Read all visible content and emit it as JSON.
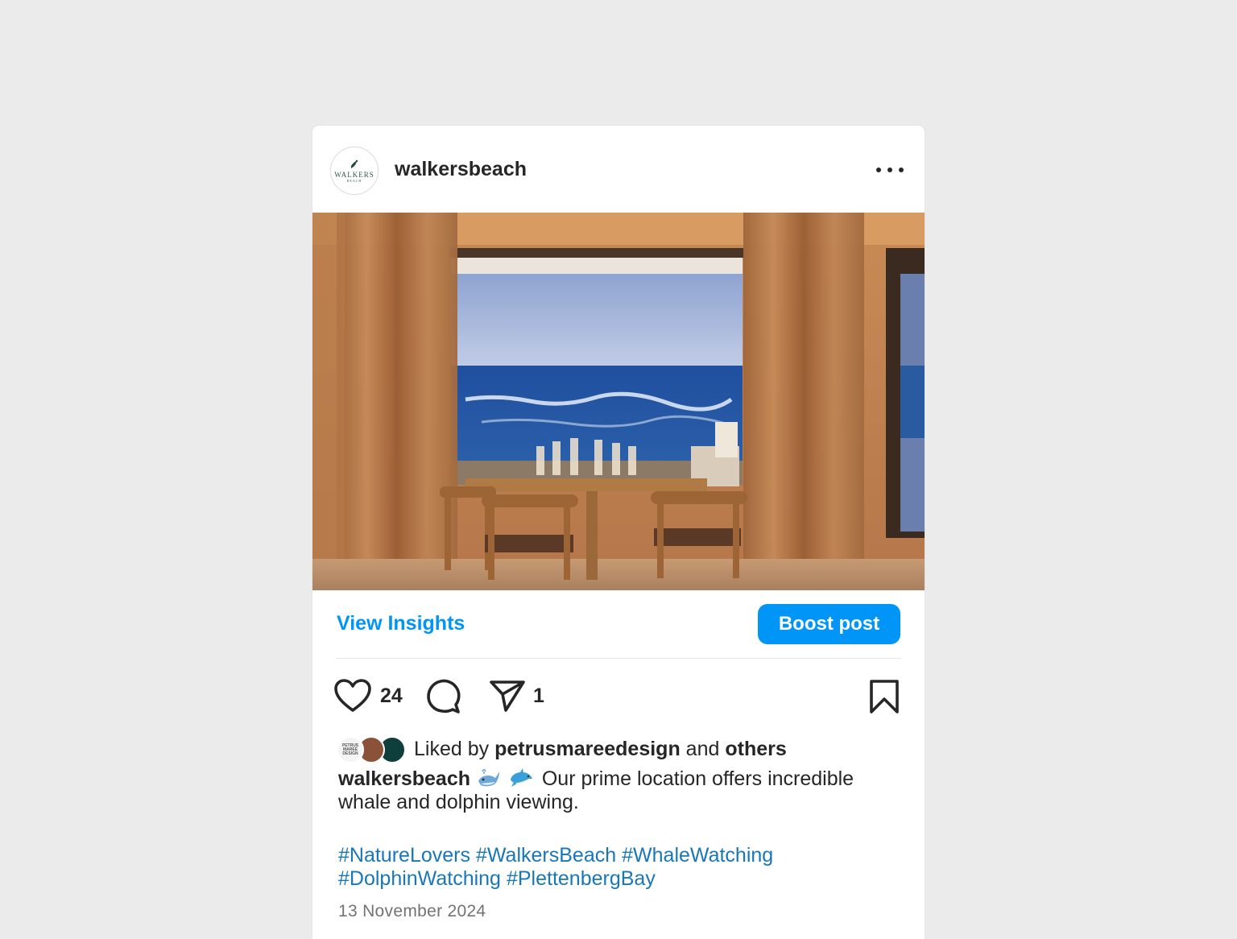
{
  "post": {
    "username": "walkersbeach",
    "avatar_text": "WALKERS",
    "avatar_subtext": "BEACH",
    "more_icon": "more-horizontal-icon"
  },
  "actions": {
    "view_insights": "View Insights",
    "boost_post": "Boost post",
    "like_count": "24",
    "share_count": "1",
    "icons": [
      "heart-icon",
      "comment-icon",
      "share-icon",
      "bookmark-icon"
    ]
  },
  "likes": {
    "prefix": "Liked by",
    "user": "petrusmareedesign",
    "connector": "and",
    "others": "others",
    "avatar1_text": "PETRUS MAREE DESIGN"
  },
  "caption": {
    "username": "walkersbeach",
    "emojis": [
      "whale-emoji",
      "dolphin-emoji"
    ],
    "text": "Our prime location offers incredible whale and dolphin viewing.",
    "hashtags": [
      "#NatureLovers",
      "#WalkersBeach",
      "#WhaleWatching",
      "#DolphinWatching",
      "#PlettenbergBay"
    ]
  },
  "date": "13 November 2024",
  "colors": {
    "accent": "#0095f6",
    "hashtag": "#1877b8",
    "background": "#ebebeb"
  }
}
